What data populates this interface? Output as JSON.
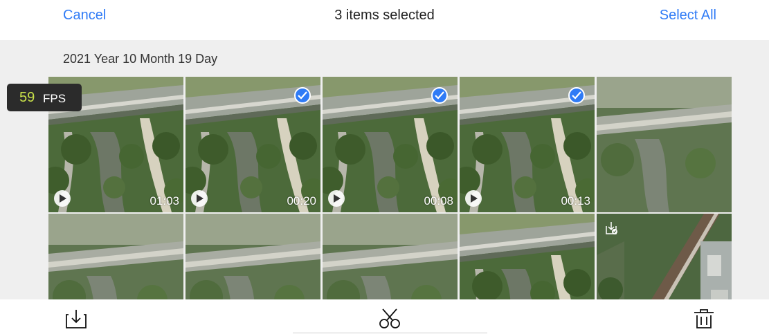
{
  "header": {
    "cancel_label": "Cancel",
    "title": "3 items selected",
    "select_all_label": "Select All"
  },
  "section": {
    "date_label": "2021 Year 10 Month 19 Day"
  },
  "fps_overlay": {
    "value": "59",
    "unit": "FPS"
  },
  "thumbnails": [
    {
      "type": "video",
      "duration": "01:03",
      "selected": false
    },
    {
      "type": "video",
      "duration": "00:20",
      "selected": true
    },
    {
      "type": "video",
      "duration": "00:08",
      "selected": true
    },
    {
      "type": "video",
      "duration": "00:13",
      "selected": true
    },
    {
      "type": "photo",
      "selected": false
    },
    {
      "type": "photo",
      "selected": false
    },
    {
      "type": "photo",
      "selected": false
    },
    {
      "type": "photo",
      "selected": false
    },
    {
      "type": "photo",
      "selected": false
    },
    {
      "type": "photo",
      "badge_icon": "downloaded-icon",
      "selected": false
    }
  ],
  "toolbar": {
    "items": [
      "download-icon",
      "scissors-icon",
      "trash-icon"
    ]
  },
  "colors": {
    "accent": "#2f7bf6",
    "fps_value": "#c8e04a",
    "grid_background": "#efefef"
  }
}
